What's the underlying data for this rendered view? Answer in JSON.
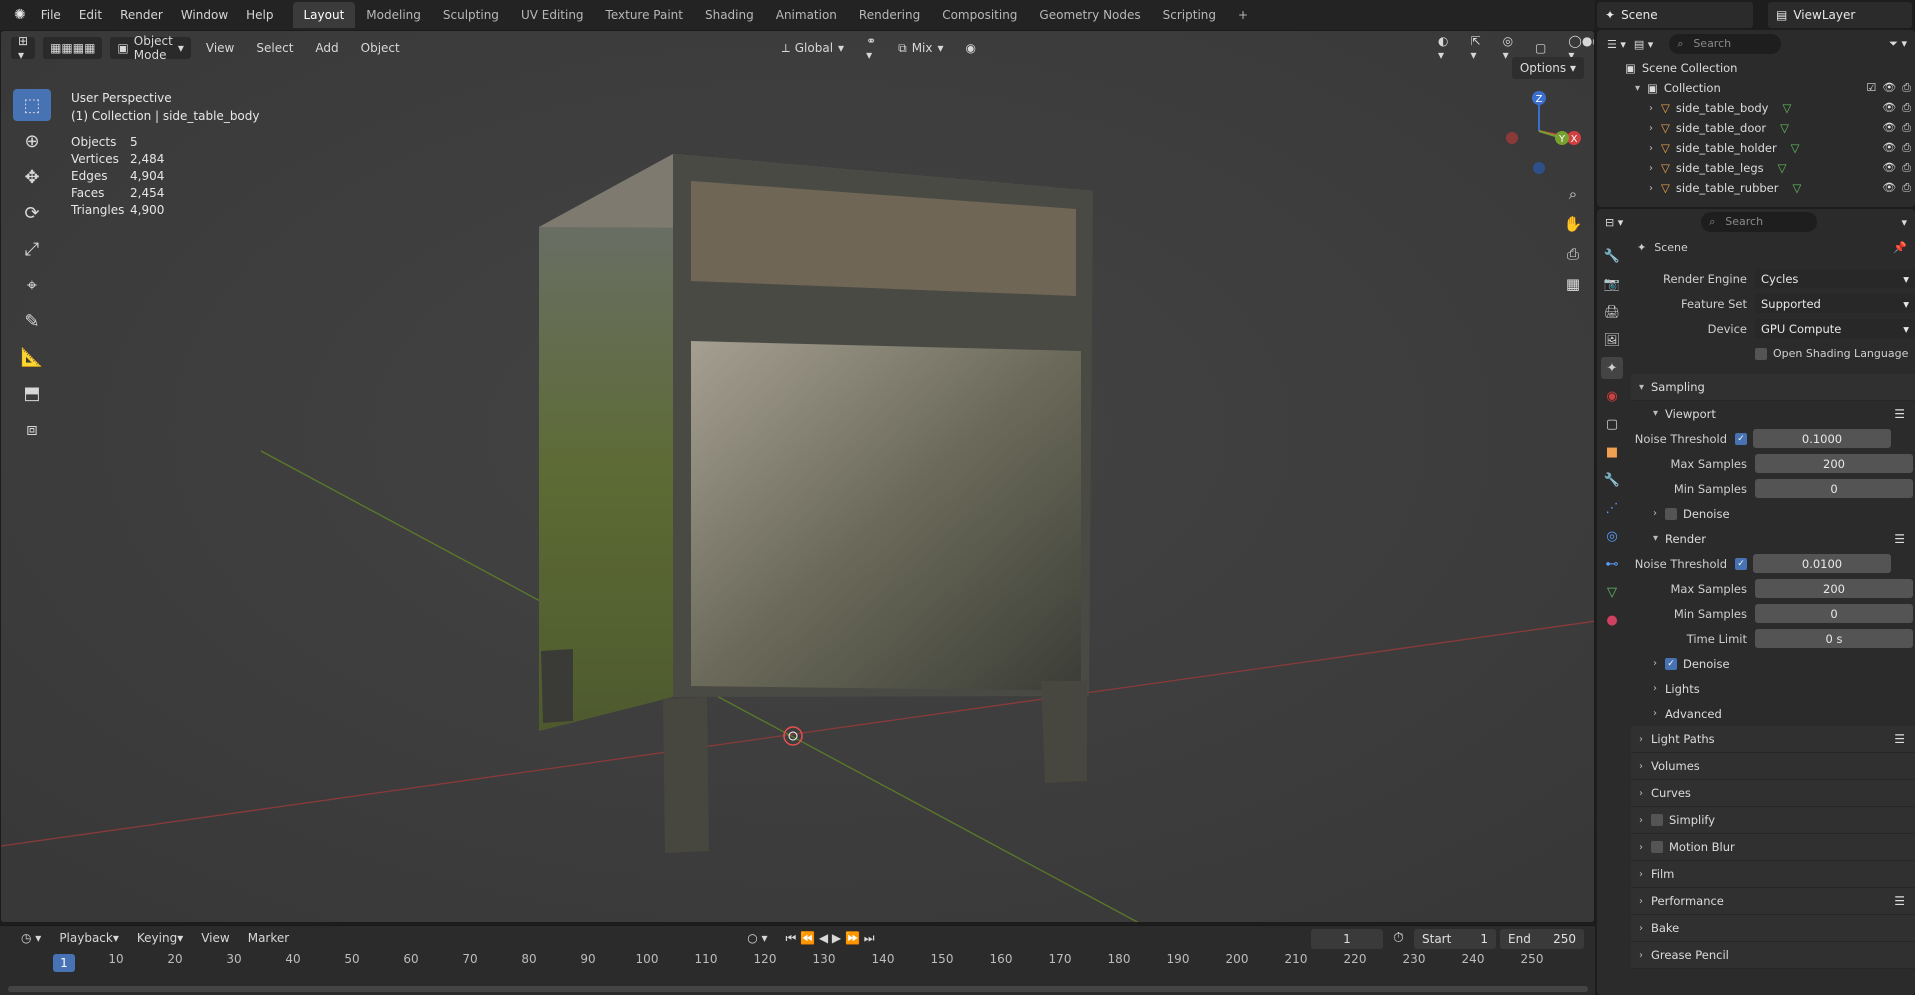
{
  "topbar": {
    "menus": [
      "File",
      "Edit",
      "Render",
      "Window",
      "Help"
    ],
    "workspace_tabs": [
      "Layout",
      "Modeling",
      "Sculpting",
      "UV Editing",
      "Texture Paint",
      "Shading",
      "Animation",
      "Rendering",
      "Compositing",
      "Geometry Nodes",
      "Scripting"
    ],
    "active_tab": "Layout",
    "scene": "Scene",
    "view_layer": "ViewLayer"
  },
  "viewport": {
    "mode": "Object Mode",
    "menus": [
      "View",
      "Select",
      "Add",
      "Object"
    ],
    "transform_orientation": "Global",
    "snap_mode": "Mix",
    "options_label": "Options",
    "perspective_label": "User Perspective",
    "collection_label": "(1) Collection | side_table_body",
    "stats": [
      {
        "label": "Objects",
        "value": "5"
      },
      {
        "label": "Vertices",
        "value": "2,484"
      },
      {
        "label": "Edges",
        "value": "4,904"
      },
      {
        "label": "Faces",
        "value": "2,454"
      },
      {
        "label": "Triangles",
        "value": "4,900"
      }
    ],
    "gizmo": {
      "x": "X",
      "y": "Y",
      "z": "Z"
    }
  },
  "timeline": {
    "menus": [
      "Playback",
      "Keying",
      "View",
      "Marker"
    ],
    "current_frame": "1",
    "start_label": "Start",
    "start": "1",
    "end_label": "End",
    "end": "250",
    "ticks": [
      "10",
      "20",
      "30",
      "40",
      "50",
      "60",
      "70",
      "80",
      "90",
      "100",
      "110",
      "120",
      "130",
      "140",
      "150",
      "160",
      "170",
      "180",
      "190",
      "200",
      "210",
      "220",
      "230",
      "240",
      "250"
    ],
    "marker_label": "1"
  },
  "outliner": {
    "search_placeholder": "Search",
    "scene_collection": "Scene Collection",
    "collection": "Collection",
    "objects": [
      "side_table_body",
      "side_table_door",
      "side_table_holder",
      "side_table_legs",
      "side_table_rubber"
    ]
  },
  "properties": {
    "search_placeholder": "Search",
    "context": "Scene",
    "render_engine_label": "Render Engine",
    "render_engine": "Cycles",
    "feature_set_label": "Feature Set",
    "feature_set": "Supported",
    "device_label": "Device",
    "device": "GPU Compute",
    "osl_label": "Open Shading Language",
    "sampling": {
      "title": "Sampling",
      "viewport_title": "Viewport",
      "viewport_noise_label": "Noise Threshold",
      "viewport_noise": "0.1000",
      "viewport_max_label": "Max Samples",
      "viewport_max": "200",
      "viewport_min_label": "Min Samples",
      "viewport_min": "0",
      "viewport_denoise": "Denoise",
      "render_title": "Render",
      "render_noise_label": "Noise Threshold",
      "render_noise": "0.0100",
      "render_max_label": "Max Samples",
      "render_max": "200",
      "render_min_label": "Min Samples",
      "render_min": "0",
      "time_limit_label": "Time Limit",
      "time_limit": "0 s",
      "render_denoise": "Denoise",
      "lights": "Lights",
      "advanced": "Advanced"
    },
    "panels": [
      "Light Paths",
      "Volumes",
      "Curves",
      "Simplify",
      "Motion Blur",
      "Film",
      "Performance",
      "Bake",
      "Grease Pencil"
    ]
  }
}
